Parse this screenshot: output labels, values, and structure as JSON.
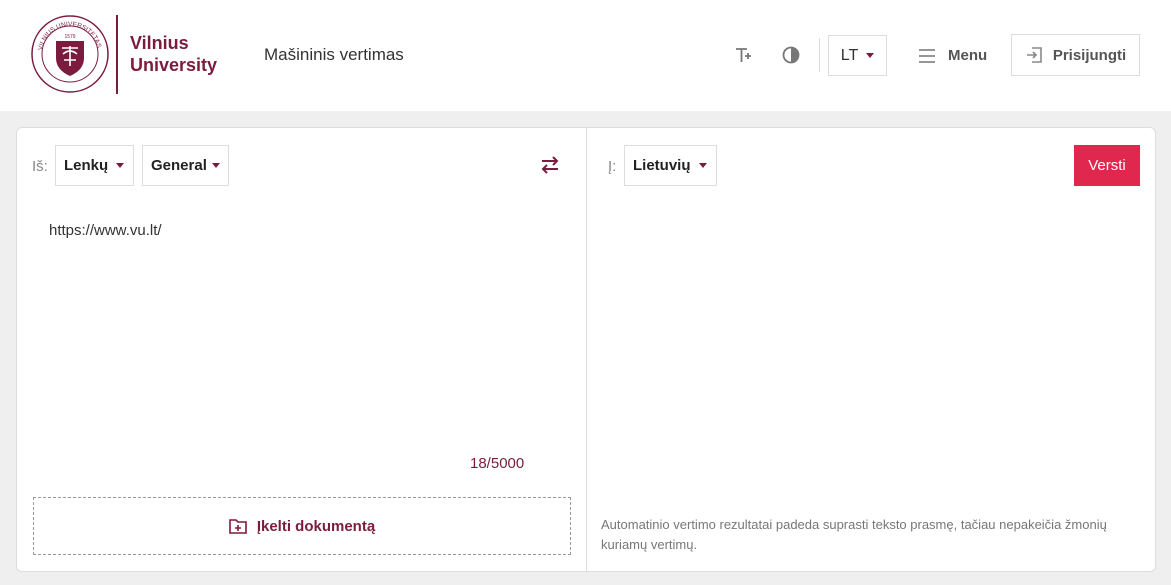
{
  "header": {
    "logo_line1": "Vilnius",
    "logo_line2": "University",
    "seal_year": "1579",
    "seal_text": "VILNIUS UNIVERSITETAS",
    "app_title": "Mašininis vertimas",
    "interface_language": "LT",
    "menu_label": "Menu",
    "login_label": "Prisijungti"
  },
  "source": {
    "from_label": "Iš:",
    "language": "Lenkų",
    "domain": "General",
    "text": "https://www.vu.lt/",
    "counter": "18/5000",
    "upload_label": "Įkelti dokumentą"
  },
  "target": {
    "to_label": "Į:",
    "language": "Lietuvių",
    "translate_label": "Versti",
    "disclaimer": "Automatinio vertimo rezultatai padeda suprasti teksto prasmę, tačiau nepakeičia žmonių kuriamų vertimų."
  },
  "colors": {
    "brand": "#7b1c3e",
    "action": "#e0284e"
  }
}
